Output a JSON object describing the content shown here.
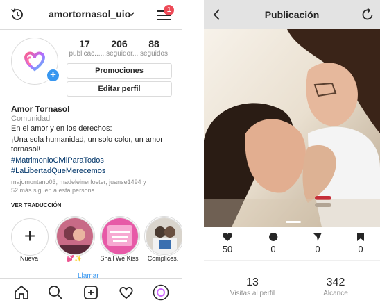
{
  "profile": {
    "username": "amortornasol_uio",
    "notification_count": "1",
    "stats": [
      {
        "value": "17",
        "label": "publicac..."
      },
      {
        "value": "206",
        "label": "...seguidor..."
      },
      {
        "value": "88",
        "label": "seguidos"
      }
    ],
    "promotions_button": "Promociones",
    "edit_button": "Editar perfil",
    "name": "Amor Tornasol",
    "category": "Comunidad",
    "bio_line1": "En el amor y en los derechos:",
    "bio_line2": "¡Una sola humanidad, un solo color, un amor",
    "bio_line3": "tornasol!",
    "hashtag1": "#MatrimonioCivilParaTodos",
    "hashtag2": "#LaLibertadQueMerecemos",
    "followed_by_line1": "majomontano03, madeleinerfoster, juanse1494 y",
    "followed_by_line2": "52 más siguen a esta persona",
    "translate": "VER TRADUCCIÓN",
    "call_link": "Llamar",
    "highlights": [
      {
        "label": "Nueva"
      },
      {
        "label": "💕✨"
      },
      {
        "label": "Shall We Kiss"
      },
      {
        "label": "Complices."
      }
    ]
  },
  "publication": {
    "title": "Publicación",
    "actions": [
      {
        "icon": "heart-icon",
        "value": "50"
      },
      {
        "icon": "comment-icon",
        "value": "0"
      },
      {
        "icon": "send-icon",
        "value": "0"
      },
      {
        "icon": "bookmark-icon",
        "value": "0"
      }
    ],
    "profile_visits": {
      "value": "13",
      "label": "Visitas al perfil"
    },
    "reach": {
      "value": "342",
      "label": "Alcance"
    }
  },
  "colors": {
    "accent": "#3897f0",
    "badge": "#ed4956",
    "hashtag": "#003569"
  }
}
